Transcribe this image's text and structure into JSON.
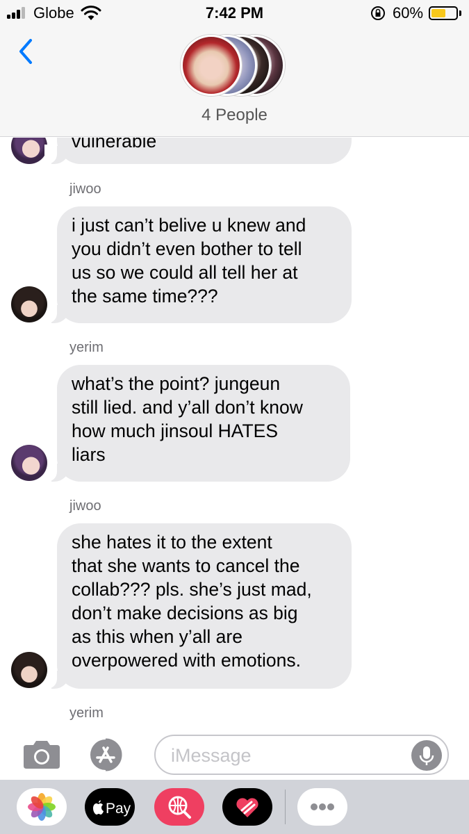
{
  "status_bar": {
    "carrier": "Globe",
    "time": "7:42 PM",
    "battery_percent": "60%",
    "battery_level": 0.6,
    "battery_color": "#f8c81c"
  },
  "header": {
    "back_icon": "chevron-left-icon",
    "participants_label": "4 People",
    "accent_color": "#007aff"
  },
  "thread": {
    "partial_message": "vulnerable",
    "messages": [
      {
        "sender": "jiwoo",
        "text": "i just can’t belive u knew and\nyou didn’t even bother to tell\nus so we could all tell her at\nthe same time???"
      },
      {
        "sender": "yerim",
        "text": "what’s the point? jungeun\nstill lied. and y’all don’t know\nhow much jinsoul HATES\nliars"
      },
      {
        "sender": "jiwoo",
        "text": "she hates it to the extent\nthat she wants to cancel the\ncollab??? pls. she’s just mad,\ndon’t make decisions as big\nas this when y’all are\noverpowered with emotions."
      }
    ],
    "trailing_sender": "yerim",
    "bubble_color": "#e9e9eb"
  },
  "input_bar": {
    "placeholder": "iMessage",
    "camera_icon": "camera-icon",
    "appstore_icon": "app-store-icon",
    "mic_icon": "microphone-icon"
  },
  "app_drawer": {
    "apps": [
      {
        "name": "photos-app-icon",
        "label": ""
      },
      {
        "name": "apple-pay-icon",
        "label": "Pay"
      },
      {
        "name": "web-images-icon",
        "label": ""
      },
      {
        "name": "digital-touch-icon",
        "label": ""
      },
      {
        "name": "more-apps-icon",
        "label": ""
      }
    ]
  }
}
